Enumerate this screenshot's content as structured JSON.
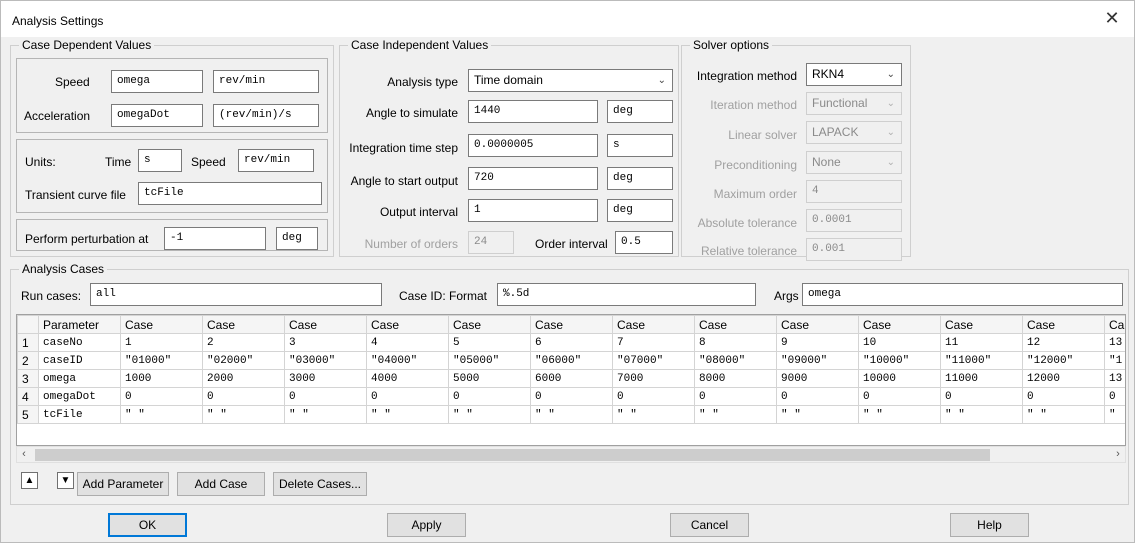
{
  "window": {
    "title": "Analysis Settings",
    "close_glyph": "✕"
  },
  "case_dependent": {
    "legend": "Case Dependent Values",
    "speed_label": "Speed",
    "speed_value": "omega",
    "speed_unit": "rev/min",
    "accel_label": "Acceleration",
    "accel_value": "omegaDot",
    "accel_unit": "(rev/min)/s",
    "units_label": "Units:",
    "time_label": "Time",
    "time_value": "s",
    "speed2_label": "Speed",
    "speed2_value": "rev/min",
    "transient_label": "Transient curve file",
    "transient_value": "tcFile",
    "perturb_label": "Perform perturbation at",
    "perturb_value": "-1",
    "perturb_unit": "deg"
  },
  "case_independent": {
    "legend": "Case Independent Values",
    "analysis_type_label": "Analysis type",
    "analysis_type_value": "Time domain",
    "angle_sim_label": "Angle to simulate",
    "angle_sim_value": "1440",
    "angle_sim_unit": "deg",
    "step_label": "Integration time step",
    "step_value": "0.0000005",
    "step_unit": "s",
    "start_out_label": "Angle to start output",
    "start_out_value": "720",
    "start_out_unit": "deg",
    "out_interval_label": "Output interval",
    "out_interval_value": "1",
    "out_interval_unit": "deg",
    "orders_label": "Number of orders",
    "orders_value": "24",
    "order_interval_label": "Order interval",
    "order_interval_value": "0.5"
  },
  "solver": {
    "legend": "Solver options",
    "method_label": "Integration method",
    "method_value": "RKN4",
    "iter_label": "Iteration method",
    "iter_value": "Functional",
    "linear_label": "Linear solver",
    "linear_value": "LAPACK",
    "precond_label": "Preconditioning",
    "precond_value": "None",
    "maxorder_label": "Maximum order",
    "maxorder_value": "4",
    "abstol_label": "Absolute tolerance",
    "abstol_value": "0.0001",
    "reltol_label": "Relative tolerance",
    "reltol_value": "0.001"
  },
  "analysis_cases": {
    "legend": "Analysis Cases",
    "run_label": "Run cases:",
    "run_value": "all",
    "caseid_label": "Case ID: Format",
    "caseid_value": "%.5d",
    "args_label": "Args",
    "args_value": "omega",
    "table": {
      "param_header": "Parameter",
      "case_headers": [
        "Case",
        "Case",
        "Case",
        "Case",
        "Case",
        "Case",
        "Case",
        "Case",
        "Case",
        "Case",
        "Case",
        "Case",
        "Ca"
      ],
      "rows": [
        {
          "num": "1",
          "param": "caseNo",
          "values": [
            "1",
            "2",
            "3",
            "4",
            "5",
            "6",
            "7",
            "8",
            "9",
            "10",
            "11",
            "12",
            "13"
          ]
        },
        {
          "num": "2",
          "param": "caseID",
          "values": [
            "\"01000\"",
            "\"02000\"",
            "\"03000\"",
            "\"04000\"",
            "\"05000\"",
            "\"06000\"",
            "\"07000\"",
            "\"08000\"",
            "\"09000\"",
            "\"10000\"",
            "\"11000\"",
            "\"12000\"",
            "\"1"
          ]
        },
        {
          "num": "3",
          "param": "omega",
          "values": [
            "1000",
            "2000",
            "3000",
            "4000",
            "5000",
            "6000",
            "7000",
            "8000",
            "9000",
            "10000",
            "11000",
            "12000",
            "13"
          ]
        },
        {
          "num": "4",
          "param": "omegaDot",
          "values": [
            "0",
            "0",
            "0",
            "0",
            "0",
            "0",
            "0",
            "0",
            "0",
            "0",
            "0",
            "0",
            "0"
          ]
        },
        {
          "num": "5",
          "param": "tcFile",
          "values": [
            "\" \"",
            "\" \"",
            "\" \"",
            "\" \"",
            "\" \"",
            "\" \"",
            "\" \"",
            "\" \"",
            "\" \"",
            "\" \"",
            "\" \"",
            "\" \"",
            "\""
          ]
        }
      ]
    },
    "add_param": "Add Parameter",
    "add_case": "Add Case",
    "delete_cases": "Delete Cases..."
  },
  "footer": {
    "ok": "OK",
    "apply": "Apply",
    "cancel": "Cancel",
    "help": "Help"
  }
}
